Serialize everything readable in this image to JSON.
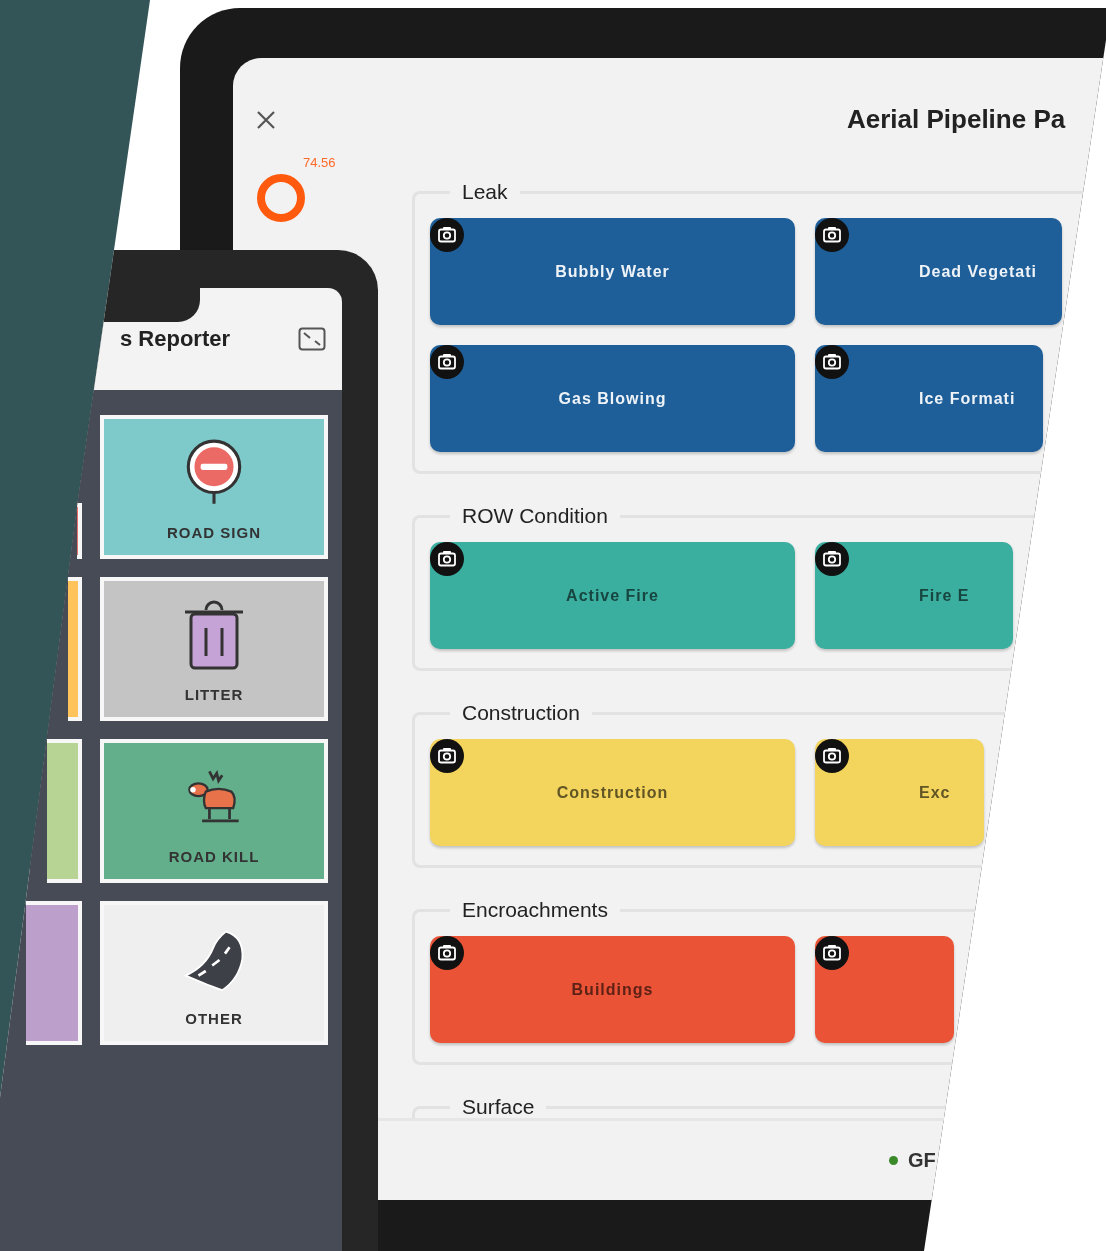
{
  "tablet": {
    "gauge_reading": "74.56",
    "title": "Aerial Pipeline Pa",
    "sections": [
      {
        "name": "Leak",
        "color": "#1f5f99",
        "buttons": [
          {
            "label": "Bubbly Water"
          },
          {
            "label": "Dead Vegetati"
          },
          {
            "label": "Gas Blowing"
          },
          {
            "label": "Ice  Formati"
          }
        ]
      },
      {
        "name": "ROW Condition",
        "color": "#3aafa0",
        "buttons": [
          {
            "label": "Active Fire"
          },
          {
            "label": "Fire E"
          }
        ]
      },
      {
        "name": "Construction",
        "color": "#f3d45c",
        "buttons": [
          {
            "label": "Construction"
          },
          {
            "label": "Exc"
          }
        ]
      },
      {
        "name": "Encroachments",
        "color": "#ea5336",
        "buttons": [
          {
            "label": "Buildings"
          }
        ],
        "trailing_blank_button": true
      },
      {
        "name": "Surface"
      }
    ],
    "status": {
      "label": "GF",
      "color": "#3a8a2a"
    }
  },
  "phone": {
    "title": "s Reporter",
    "tiles": [
      {
        "color": "#e8706a"
      },
      {
        "kind": "road-sign",
        "label": "ROAD SIGN",
        "color": "#7ecacb"
      },
      {
        "color": "#fec35a"
      },
      {
        "kind": "litter",
        "label": "LITTER",
        "color": "#c4c4c4"
      },
      {
        "color": "#b8d494"
      },
      {
        "kind": "road-kill",
        "label": "ROAD KILL",
        "color": "#63ae8b"
      },
      {
        "color": "#bd9fcb"
      },
      {
        "kind": "other",
        "label": "OTHER",
        "color": "#efefef"
      }
    ]
  }
}
